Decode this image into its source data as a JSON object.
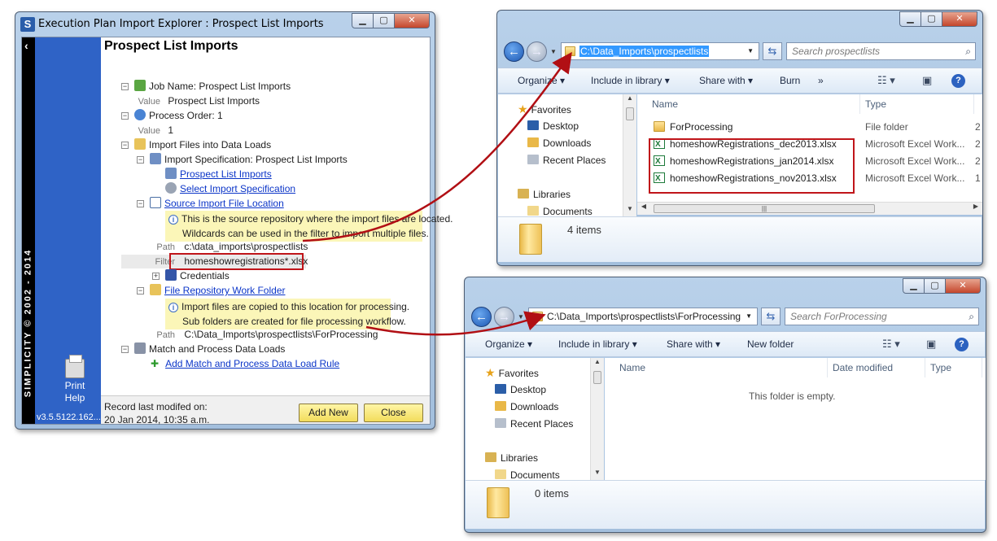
{
  "main_window": {
    "app_icon_letter": "S",
    "title": "Execution Plan Import Explorer : Prospect List Imports",
    "panel_title": "Prospect List Imports",
    "brand_vertical": "SIMPLICITY © 2002 - 2014",
    "print_label": "Print",
    "help_label": "Help",
    "version": "v3.5.5122.162...",
    "tree": {
      "job_name": "Job Name:  Prospect List Imports",
      "value_label": "Value",
      "job_value": "Prospect List Imports",
      "process_order": "Process Order:  1",
      "process_value": "1",
      "import_files": "Import Files into Data Loads",
      "import_spec": "Import Specification:  Prospect List Imports",
      "prospect_link": "Prospect List Imports",
      "select_spec_link": "Select Import Specification",
      "source_loc_link": "Source Import File Location",
      "source_note_1": "This is the source repository where the import files are located.",
      "source_note_2": "Wildcards can be used in the filter to import multiple files.",
      "path_label": "Path",
      "source_path": "c:\\data_imports\\prospectlists",
      "filter_label": "Filter",
      "filter_value": "homeshowregistrations*.xlsx",
      "credentials": "Credentials",
      "repo_link": "File Repository Work Folder",
      "repo_note_1": "Import files are copied to this location for processing.",
      "repo_note_2": "Sub folders are created for file processing workflow.",
      "repo_path": "C:\\Data_Imports\\prospectlists\\ForProcessing",
      "match_process": "Match and Process Data Loads",
      "add_rule_link": "Add Match and Process Data Load Rule"
    },
    "footer": {
      "record_label": "Record last modifed on:",
      "record_value": "20 Jan 2014, 10:35 a.m.",
      "add_new": "Add New",
      "close": "Close"
    }
  },
  "explorer1": {
    "address": "C:\\Data_Imports\\prospectlists",
    "search_placeholder": "Search prospectlists",
    "commands": {
      "organize": "Organize ▾",
      "include": "Include in library ▾",
      "share": "Share with ▾",
      "burn": "Burn",
      "more": "»"
    },
    "nav": {
      "favorites": "Favorites",
      "desktop": "Desktop",
      "downloads": "Downloads",
      "recent": "Recent Places",
      "libraries": "Libraries",
      "documents": "Documents"
    },
    "columns": {
      "name": "Name",
      "type": "Type"
    },
    "files": [
      {
        "name": "ForProcessing",
        "type": "File folder",
        "extra": "2"
      },
      {
        "name": "homeshowRegistrations_dec2013.xlsx",
        "type": "Microsoft Excel Work...",
        "extra": "2"
      },
      {
        "name": "homeshowRegistrations_jan2014.xlsx",
        "type": "Microsoft Excel Work...",
        "extra": "2"
      },
      {
        "name": "homeshowRegistrations_nov2013.xlsx",
        "type": "Microsoft Excel Work...",
        "extra": "1"
      }
    ],
    "items_count": "4 items"
  },
  "explorer2": {
    "address": "C:\\Data_Imports\\prospectlists\\ForProcessing",
    "search_placeholder": "Search ForProcessing",
    "commands": {
      "organize": "Organize ▾",
      "include": "Include in library ▾",
      "share": "Share with ▾",
      "new_folder": "New folder"
    },
    "nav": {
      "favorites": "Favorites",
      "desktop": "Desktop",
      "downloads": "Downloads",
      "recent": "Recent Places",
      "libraries": "Libraries",
      "documents": "Documents"
    },
    "columns": {
      "name": "Name",
      "date": "Date modified",
      "type": "Type"
    },
    "empty_message": "This folder is empty.",
    "items_count": "0 items"
  },
  "colors": {
    "accent_red": "#c0151a",
    "sidebar_blue": "#2f63c6",
    "link_blue": "#0b35c8",
    "note_yellow": "#fbf6b8"
  }
}
